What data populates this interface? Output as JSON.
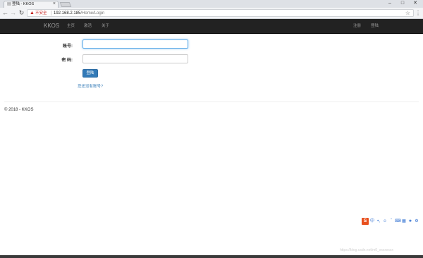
{
  "browser": {
    "tab_title": "登陆 - KKOS",
    "insecure_label": "不安全",
    "url_host": "192.168.2.185",
    "url_path": "/Home/Login",
    "window_controls": [
      "–",
      "□",
      "✕"
    ]
  },
  "navbar": {
    "brand": "KKOS",
    "links": [
      "主页",
      "激活",
      "关于"
    ],
    "right_links": [
      "注册",
      "登陆"
    ]
  },
  "form": {
    "account_label": "账号:",
    "password_label": "密 码:",
    "account_value": "",
    "password_value": "",
    "submit_label": "登陆",
    "register_link": "您还没有账号?"
  },
  "footer": {
    "text": "© 2018 - KKOS"
  },
  "ime": {
    "logo": "S",
    "icons": [
      "中",
      "•,",
      "☺",
      "̂",
      "⌨",
      "▦",
      "★",
      "⚙"
    ]
  },
  "watermark": "https://blog.csdn.net/m0_xxxxxxxx"
}
